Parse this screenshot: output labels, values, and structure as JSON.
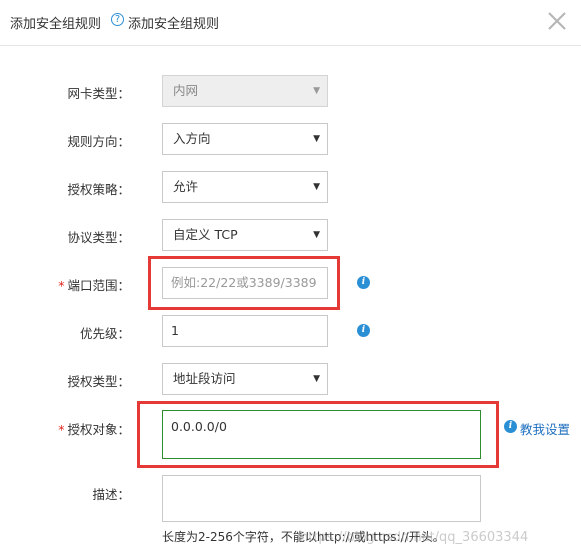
{
  "dialog": {
    "title": "添加安全组规则",
    "help_text": "添加安全组规则",
    "help_icon": "question-circle-icon",
    "close_icon": "close-icon"
  },
  "form": {
    "nic_type": {
      "label": "网卡类型：",
      "value": "内网"
    },
    "direction": {
      "label": "规则方向：",
      "value": "入方向"
    },
    "policy": {
      "label": "授权策略：",
      "value": "允许"
    },
    "protocol": {
      "label": "协议类型：",
      "value": "自定义 TCP"
    },
    "port_range": {
      "label": "端口范围：",
      "required_mark": "*",
      "placeholder": "例如:22/22或3389/3389"
    },
    "priority": {
      "label": "优先级：",
      "value": "1"
    },
    "auth_type": {
      "label": "授权类型：",
      "value": "地址段访问"
    },
    "auth_object": {
      "label": "授权对象：",
      "required_mark": "*",
      "value": "0.0.0.0/0",
      "help_link": "教我设置"
    },
    "description": {
      "label": "描述：",
      "value": "",
      "hint": "长度为2-256个字符，不能以http://或https://开头。"
    }
  },
  "info_icon_glyph": "i",
  "watermark": "https://blog.csdn.net/qq_36603344",
  "colors": {
    "highlight": "#e53935",
    "link": "#1f6fbf",
    "focus_border": "#2e8b2e",
    "required": "#e1251b"
  }
}
